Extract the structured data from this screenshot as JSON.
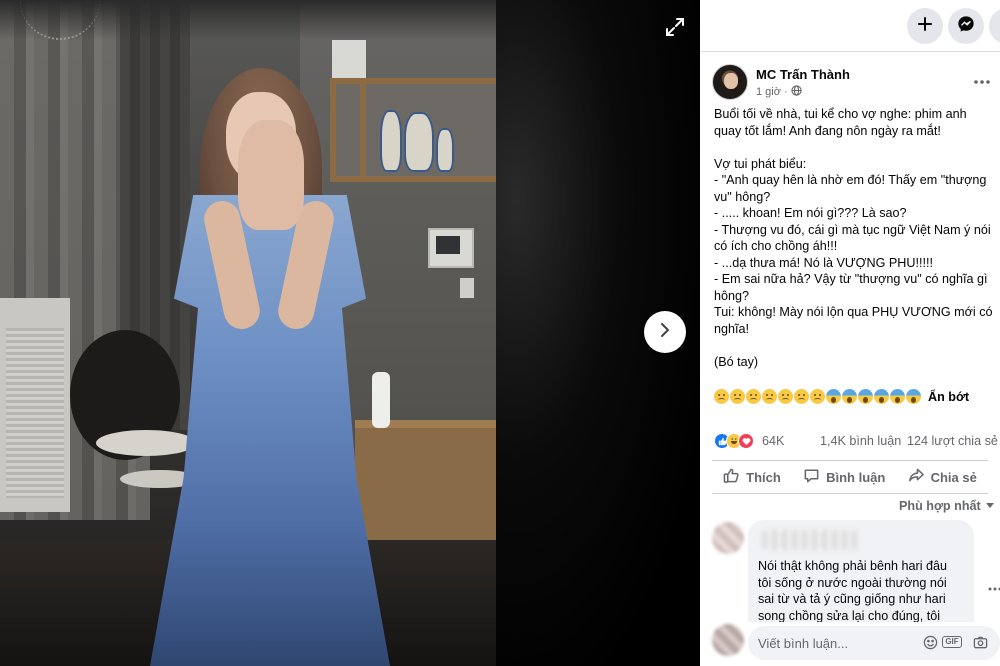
{
  "viewer": {
    "expand_icon": "expand-icon",
    "next_icon": "chevron-right-icon"
  },
  "topbar": {
    "create_icon": "plus-icon",
    "messenger_icon": "messenger-icon",
    "menu_icon": "grid-icon"
  },
  "post": {
    "author": "MC Trấn Thành",
    "time": "1 giờ",
    "privacy_icon": "globe-icon",
    "lines_a": [
      "Buổi tối về nhà, tui kể cho vợ nghe: phim anh",
      "quay tốt lắm! Anh đang nôn ngày ra mắt!"
    ],
    "lines_b": [
      "Vợ tui phát biểu:",
      "- \"Anh quay hên là nhờ em đó! Thấy em \"thượng",
      "vu\" hông?",
      "- ..... khoan! Em nói gì??? Là sao?",
      "- Thượng vu đó, cái gì mà tục ngữ Việt Nam ý nói",
      "có ích cho chồng áh!!!",
      "- ...dạ thưa má! Nó là VƯỢNG PHU!!!!!",
      "- Em sai nữa hả? Vậy từ \"thượng vu\" có nghĩa gì",
      "hông?",
      "Tui: không! Mày nói lộn qua PHỤ VƯƠNG mới có",
      "nghĩa!"
    ],
    "line_c": "(Bó tay)",
    "see_less": "Ẩn bớt"
  },
  "stats": {
    "reactions": "64K",
    "comments": "1,4K bình luận",
    "shares": "124 lượt chia sẻ"
  },
  "actions": {
    "like": "Thích",
    "comment": "Bình luận",
    "share": "Chia sẻ"
  },
  "sort": {
    "label": "Phù hợp nhất"
  },
  "comment": {
    "lines": [
      "Nói thật không phải bênh hari đâu",
      "tôi sống ở nước ngoài thường nói",
      "sai từ và tả ý cũng giống như hari",
      "song chồng sửa lại cho đúng, tôi"
    ]
  },
  "composer": {
    "placeholder": "Viết bình luận..."
  },
  "colors": {
    "accent": "#1877f2",
    "text": "#050505",
    "muted": "#65676b",
    "bubble": "#f0f2f5"
  }
}
